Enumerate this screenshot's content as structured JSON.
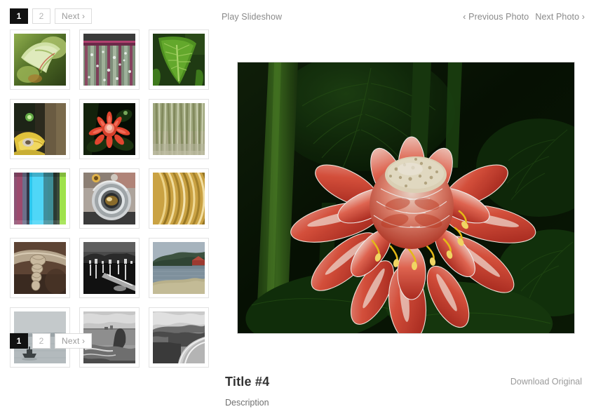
{
  "pagination_top": {
    "name": "thumbnail-pagination-top",
    "pages": [
      {
        "label": "1",
        "current": true
      },
      {
        "label": "2",
        "current": false
      }
    ],
    "next_label": "Next ›"
  },
  "pagination_bottom": {
    "name": "thumbnail-pagination-bottom",
    "pages": [
      {
        "label": "1",
        "current": true
      },
      {
        "label": "2",
        "current": false
      }
    ],
    "next_label": "Next ›"
  },
  "toolbar": {
    "play_slideshow_label": "Play Slideshow",
    "previous_photo_label": "‹ Previous Photo",
    "next_photo_label": "Next Photo ›"
  },
  "main_photo": {
    "alt": "Red torch ginger flower against dark green tropical foliage",
    "selected_thumbnail_index": 4,
    "title": "Title #4",
    "description": "Description",
    "download_label": "Download Original"
  },
  "thumbnails": [
    {
      "index": 0,
      "alt": "Pale green curled banana leaf",
      "selected": false
    },
    {
      "index": 1,
      "alt": "Water droplets on striped magenta leaf",
      "selected": false
    },
    {
      "index": 2,
      "alt": "Large green heart-shaped taro leaf",
      "selected": false
    },
    {
      "index": 3,
      "alt": "Yellow cacao pods split open",
      "selected": false
    },
    {
      "index": 4,
      "alt": "Red torch ginger flower on black",
      "selected": true
    },
    {
      "index": 5,
      "alt": "Pale bamboo forest stalks",
      "selected": false
    },
    {
      "index": 6,
      "alt": "Vertical color bars test pattern",
      "selected": false
    },
    {
      "index": 7,
      "alt": "Vintage camera lens close-up",
      "selected": false
    },
    {
      "index": 8,
      "alt": "Golden coiled metal spring",
      "selected": false
    },
    {
      "index": 9,
      "alt": "Knotted rope on driftwood",
      "selected": false
    },
    {
      "index": 10,
      "alt": "Black and white harbour at night",
      "selected": false
    },
    {
      "index": 11,
      "alt": "Lake shore with red boathouse",
      "selected": false
    },
    {
      "index": 12,
      "alt": "Small fishing boat in grey fog",
      "selected": false
    },
    {
      "index": 13,
      "alt": "Monochrome sea cliffs and surf",
      "selected": false
    },
    {
      "index": 14,
      "alt": "Coastal highway in black and white",
      "selected": false
    }
  ],
  "colors": {
    "page_background": "#ffffff",
    "text_muted": "#8a8a8a",
    "title_text": "#333333",
    "pager_current_bg": "#111111",
    "pager_border": "#dcdcdc",
    "thumb_border": "#e2e2e2",
    "photo_border": "#d8d8d8"
  }
}
